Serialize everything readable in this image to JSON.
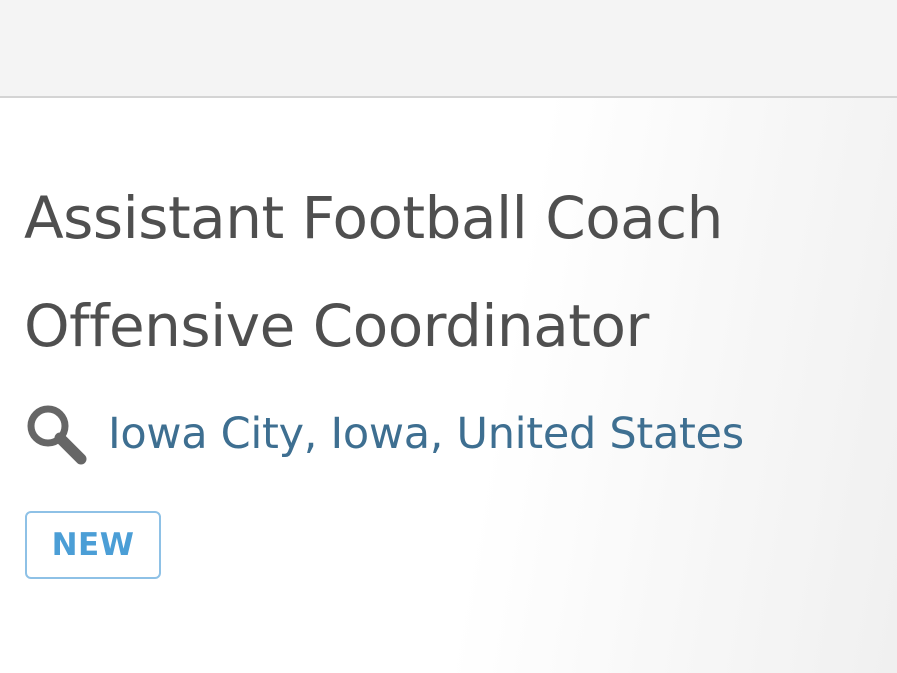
{
  "job": {
    "title_line_1": "Assistant Football Coach",
    "title_line_2": "Offensive Coordinator",
    "location": "Iowa City, Iowa, United States",
    "location_icon": "search-icon",
    "badge": "NEW"
  },
  "colors": {
    "title_text": "#4f4f4f",
    "location_link": "#3e6f91",
    "badge_text": "#4b9ed6",
    "badge_border": "#8ec1e6",
    "top_bar": "#f4f4f4"
  }
}
